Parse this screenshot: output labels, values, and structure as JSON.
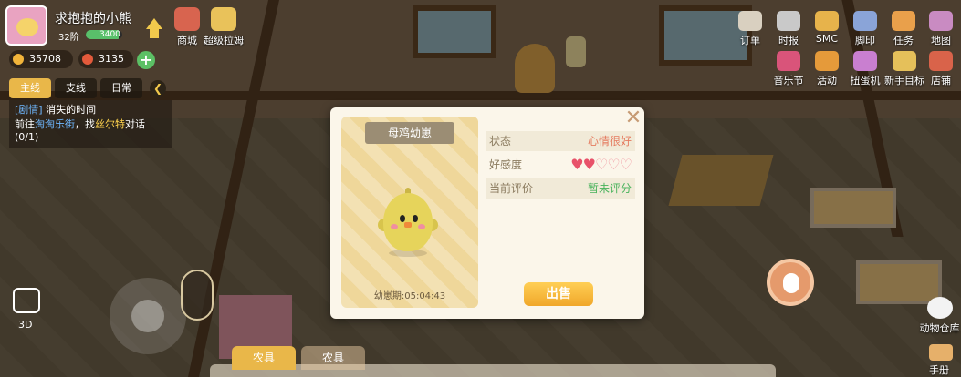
{
  "player": {
    "name": "求抱抱的小熊",
    "level": "32阶",
    "xp_text": "3400",
    "xp_fraction": 0.9
  },
  "shop_icons": [
    {
      "label": "商城",
      "icon": "shop-icon",
      "color": "#d8644f"
    },
    {
      "label": "超级拉姆",
      "icon": "super-lam-icon",
      "color": "#e9c25a"
    }
  ],
  "currency": [
    {
      "value": "35708",
      "icon": "gold-coin-icon",
      "color": "#f2b43a"
    },
    {
      "value": "3135",
      "icon": "gem-icon",
      "color": "#e35a3b"
    }
  ],
  "quest_tabs": [
    {
      "label": "主线",
      "active": true
    },
    {
      "label": "支线",
      "active": false
    },
    {
      "label": "日常",
      "active": false
    }
  ],
  "quest": {
    "tag": "[剧情]",
    "title": "消失的时间",
    "desc_prefix": "前往",
    "desc_place": "淘淘乐街",
    "desc_mid": "，找",
    "desc_npc": "丝尔特",
    "desc_suffix": "对话",
    "progress": "(0/1)"
  },
  "right_icons_row1": [
    {
      "label": "订单",
      "icon": "order-icon",
      "color": "#d9d0c0"
    },
    {
      "label": "时报",
      "icon": "newspaper-icon",
      "color": "#c9c9c9"
    },
    {
      "label": "SMC",
      "icon": "smc-icon",
      "color": "#e7b34b"
    },
    {
      "label": "脚印",
      "icon": "footprint-icon",
      "color": "#8aa4d8"
    },
    {
      "label": "任务",
      "icon": "task-icon",
      "color": "#e9a04b"
    },
    {
      "label": "地图",
      "icon": "map-icon",
      "color": "#c98bc2"
    }
  ],
  "right_icons_row2": [
    {
      "label": "音乐节",
      "icon": "music-festival-icon",
      "color": "#d9547a"
    },
    {
      "label": "活动",
      "icon": "event-icon",
      "color": "#e59a3a"
    },
    {
      "label": "扭蛋机",
      "icon": "gacha-icon",
      "color": "#c97fd0"
    },
    {
      "label": "新手目标",
      "icon": "newbie-goal-icon",
      "color": "#e5c05a"
    },
    {
      "label": "店铺",
      "icon": "store-icon",
      "color": "#d9634a"
    }
  ],
  "pet_dialog": {
    "title": "母鸡幼崽",
    "period_label": "幼崽期:05:04:43",
    "rows": [
      {
        "label": "状态",
        "value": "心情很好"
      },
      {
        "label": "好感度",
        "hearts_filled": 2,
        "hearts_total": 5
      },
      {
        "label": "当前评价",
        "value": "暂未评分"
      }
    ],
    "sell_label": "出售",
    "close": "✕"
  },
  "bottom_tabs": [
    {
      "label": "农具",
      "active": true
    },
    {
      "label": "农具",
      "active": false
    }
  ],
  "camera_label": "3D",
  "animal_storage_label": "动物仓库",
  "manual_label": "手册"
}
